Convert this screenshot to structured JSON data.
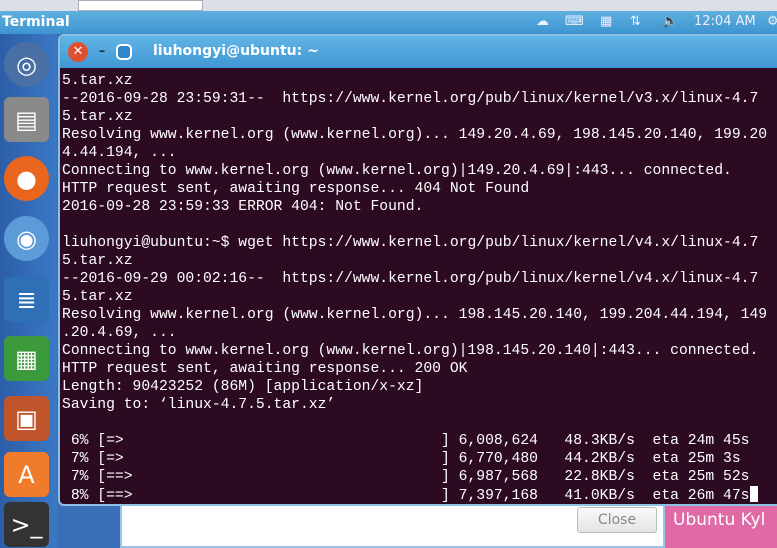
{
  "panel": {
    "app_title": "Terminal",
    "clock": "12:04 AM",
    "indicators": [
      "cloud-sync-icon",
      "keyboard-icon",
      "calendar-icon",
      "network-icon",
      "volume-icon"
    ]
  },
  "launcher": {
    "items": [
      "ubuntu-dash-icon",
      "files-icon",
      "firefox-icon",
      "chromium-icon",
      "writer-icon",
      "calc-icon",
      "impress-icon",
      "software-center-icon",
      "terminal-icon"
    ]
  },
  "terminal": {
    "title": "liuhongyi@ubuntu: ~",
    "lines": [
      "5.tar.xz",
      "--2016-09-28 23:59:31--  https://www.kernel.org/pub/linux/kernel/v3.x/linux-4.7",
      "5.tar.xz",
      "Resolving www.kernel.org (www.kernel.org)... 149.20.4.69, 198.145.20.140, 199.20",
      "4.44.194, ...",
      "Connecting to www.kernel.org (www.kernel.org)|149.20.4.69|:443... connected.",
      "HTTP request sent, awaiting response... 404 Not Found",
      "2016-09-28 23:59:33 ERROR 404: Not Found.",
      "",
      "liuhongyi@ubuntu:~$ wget https://www.kernel.org/pub/linux/kernel/v4.x/linux-4.7",
      "5.tar.xz",
      "--2016-09-29 00:02:16--  https://www.kernel.org/pub/linux/kernel/v4.x/linux-4.7",
      "5.tar.xz",
      "Resolving www.kernel.org (www.kernel.org)... 198.145.20.140, 199.204.44.194, 149",
      ".20.4.69, ...",
      "Connecting to www.kernel.org (www.kernel.org)|198.145.20.140|:443... connected.",
      "HTTP request sent, awaiting response... 200 OK",
      "Length: 90423252 (86M) [application/x-xz]",
      "Saving to: ‘linux-4.7.5.tar.xz’",
      "",
      " 6% [=>                                    ] 6,008,624   48.3KB/s  eta 24m 45s",
      " 7% [=>                                    ] 6,770,480   44.2KB/s  eta 25m 3s ",
      " 7% [==>                                   ] 6,987,568   22.8KB/s  eta 25m 52s",
      " 8% [==>                                   ] 7,397,168   41.0KB/s  eta 26m 47s"
    ]
  },
  "background": {
    "close_label": "Close",
    "banner_text": "Ubuntu Kyl"
  }
}
